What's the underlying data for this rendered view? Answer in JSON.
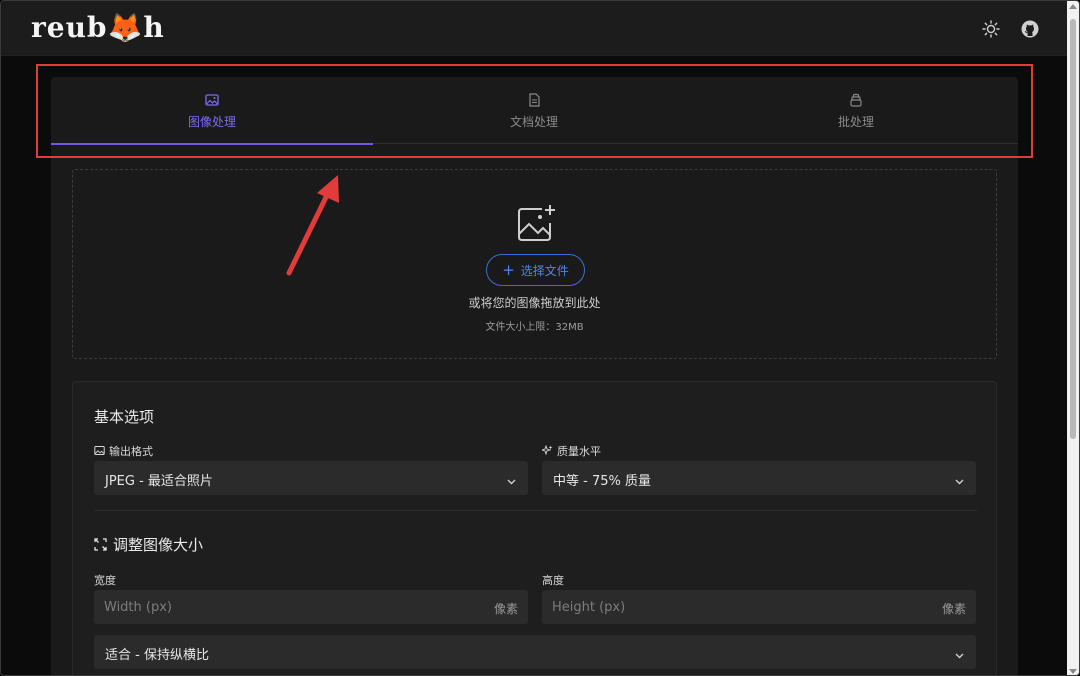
{
  "header": {
    "logo_prefix": "reub",
    "logo_fox": "🦊",
    "logo_suffix": "h",
    "theme_icon": "sun-icon",
    "github_icon": "github-icon"
  },
  "tabs": [
    {
      "label": "图像处理",
      "icon": "image-icon",
      "active": true
    },
    {
      "label": "文档处理",
      "icon": "document-icon",
      "active": false
    },
    {
      "label": "批处理",
      "icon": "layers-icon",
      "active": false
    }
  ],
  "dropzone": {
    "button_label": "选择文件",
    "hint": "或将您的图像拖放到此处",
    "limit": "文件大小上限：32MB"
  },
  "basic_options": {
    "title": "基本选项",
    "format_label": "输出格式",
    "format_value": "JPEG - 最适合照片",
    "quality_label": "质量水平",
    "quality_value": "中等 - 75% 质量"
  },
  "resize": {
    "title": "调整图像大小",
    "width_label": "宽度",
    "width_placeholder": "Width (px)",
    "width_unit": "像素",
    "height_label": "高度",
    "height_placeholder": "Height (px)",
    "height_unit": "像素",
    "fit_value": "适合 - 保持纵横比"
  },
  "colors": {
    "accent": "#6b5be6",
    "button_blue": "#3b6fd6",
    "highlight_red": "#e23b3b"
  }
}
